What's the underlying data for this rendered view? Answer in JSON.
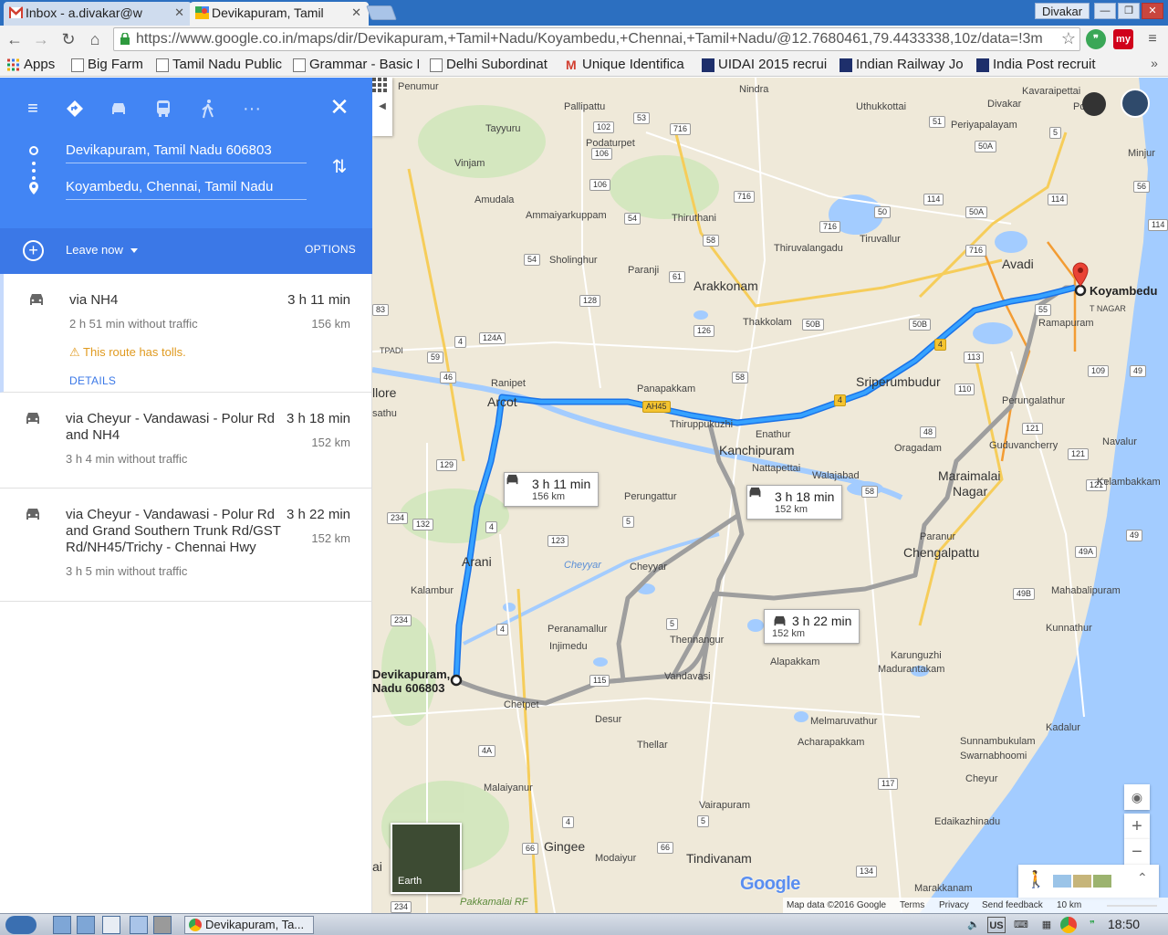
{
  "browser": {
    "tabs": [
      {
        "label": "Inbox - a.divakar@w",
        "active": false
      },
      {
        "label": "Devikapuram, Tamil",
        "active": true
      }
    ],
    "profile_name": "Divakar",
    "url": "https://www.google.co.in/maps/dir/Devikapuram,+Tamil+Nadu/Koyambedu,+Chennai,+Tamil+Nadu/@12.7680461,79.4433338,10z/data=!3m",
    "url_host": "www.google.co.in",
    "extension_label": "my",
    "bookmarks": [
      {
        "label": "Apps",
        "icon": "apps-grid-icon"
      },
      {
        "label": "Big Farm",
        "icon": "page-icon"
      },
      {
        "label": "Tamil Nadu Public",
        "icon": "page-icon"
      },
      {
        "label": "Grammar - Basic E",
        "icon": "page-icon"
      },
      {
        "label": "Delhi Subordinat",
        "icon": "page-icon"
      },
      {
        "label": "Unique Identifica",
        "icon": "gmail-icon"
      },
      {
        "label": "UIDAI 2015 recrui",
        "icon": "employment-news-icon"
      },
      {
        "label": "Indian Railway Jo",
        "icon": "employment-news-icon"
      },
      {
        "label": "India Post recruit",
        "icon": "employment-news-icon"
      }
    ]
  },
  "directions": {
    "origin": "Devikapuram, Tamil Nadu 606803",
    "destination": "Koyambedu, Chennai, Tamil Nadu",
    "leave_label": "Leave now",
    "options_label": "OPTIONS",
    "routes": [
      {
        "via": "via NH4",
        "time": "3 h 11 min",
        "distance": "156 km",
        "no_traffic": "2 h 51 min without traffic",
        "warning": "This route has tolls.",
        "details": "DETAILS",
        "selected": true
      },
      {
        "via": "via Cheyur - Vandawasi - Polur Rd and NH4",
        "time": "3 h 18 min",
        "distance": "152 km",
        "no_traffic": "3 h 4 min without traffic",
        "selected": false
      },
      {
        "via": "via Cheyur - Vandawasi - Polur Rd and Grand Southern Trunk Rd/GST Rd/NH45/Trichy - Chennai Hwy",
        "time": "3 h 22 min",
        "distance": "152 km",
        "no_traffic": "3 h 5 min without traffic",
        "selected": false
      }
    ]
  },
  "map": {
    "callouts": [
      {
        "time": "3 h 11 min",
        "distance": "156 km"
      },
      {
        "time": "3 h 18 min",
        "distance": "152 km"
      },
      {
        "time": "3 h 22 min",
        "distance": "152 km"
      }
    ],
    "start_label_line1": "Devikapuram,",
    "start_label_line2": "Nadu 606803",
    "end_label": "Koyambedu",
    "places": {
      "penumur": "Penumur",
      "nindra": "Nindra",
      "pallipattu": "Pallipattu",
      "tayyuru": "Tayyuru",
      "podaturpet": "Podaturpet",
      "uthukkottai": "Uthukkottai",
      "periyapalayam": "Periyapalayam",
      "kavaraipettai": "Kavaraipettai",
      "divakar": "Divakar",
      "ponn": "Ponn",
      "minjur": "Minjur",
      "vinjam": "Vinjam",
      "amudala": "Amudala",
      "ammaiyarkuppam": "Ammaiyarkuppam",
      "thiruthani": "Thiruthani",
      "tiruvallur": "Tiruvallur",
      "thiruvalangadu": "Thiruvalangadu",
      "sholinghur": "Sholinghur",
      "paranji": "Paranji",
      "arakkonam": "Arakkonam",
      "avadi": "Avadi",
      "koyambedu": "Koyambedu",
      "ramapuram": "Ramapuram",
      "tnagar": "T NAGAR",
      "thakkolam": "Thakkolam",
      "ranipet": "Ranipet",
      "arcot": "Arcot",
      "vellore": "llore",
      "sathu": "sathu",
      "panapakkam": "Panapakkam",
      "sriperumbudur": "Sriperumbudur",
      "perungalathur": "Perungalathur",
      "thiruppukuzhi": "Thiruppukuzhi",
      "enathur": "Enathur",
      "kanchipuram": "Kanchipuram",
      "oragadam": "Oragadam",
      "guduvancherry": "Guduvancherry",
      "navalur": "Navalur",
      "nattapettai": "Nattapettai",
      "walajabad": "Walajabad",
      "maraimalai": "Maraimalai",
      "nagar": "Nagar",
      "kelambakkam": "Kelambakkam",
      "perungattur": "Perungattur",
      "paranur": "Paranur",
      "chengalpattu": "Chengalpattu",
      "arani": "Arani",
      "cheyyar": "Cheyyar",
      "cheyyar_river": "Cheyyar",
      "kalambur": "Kalambur",
      "mahabalipuram": "Mahabalipuram",
      "peranamallur": "Peranamallur",
      "injimedu": "Injimedu",
      "thennangur": "Thennangur",
      "kunnathur": "Kunnathur",
      "alapakkam": "Alapakkam",
      "karunguzhi": "Karunguzhi",
      "madurantakam": "Madurantakam",
      "vandavasi": "Vandavasi",
      "chetpet": "Chetpet",
      "desur": "Desur",
      "melmaruvathur": "Melmaruvathur",
      "kadalur": "Kadalur",
      "acharapakkam": "Acharapakkam",
      "thellar": "Thellar",
      "sunnambukulam": "Sunnambukulam",
      "swarnabhoomi": "Swarnabhoomi",
      "malaiyanur": "Malaiyanur",
      "cheyur": "Cheyur",
      "vairapuram": "Vairapuram",
      "edaikazhinadu": "Edaikazhinadu",
      "gingee": "Gingee",
      "modaiyur": "Modaiyur",
      "tindivanam": "Tindivanam",
      "marakkanam": "Marakkanam",
      "pakkamalai": "Pakkamalai RF",
      "tpadi": "TPADI",
      "ai": "ai"
    },
    "earth_label": "Earth",
    "logo": "Google",
    "footer": {
      "map_data": "Map data ©2016 Google",
      "terms": "Terms",
      "privacy": "Privacy",
      "feedback": "Send feedback",
      "scale": "10 km"
    }
  },
  "taskbar": {
    "task_label": "Devikapuram, Ta...",
    "lang": "US",
    "clock": "18:50"
  }
}
